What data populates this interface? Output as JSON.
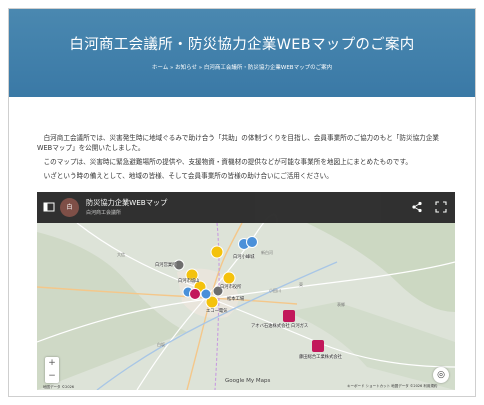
{
  "hero": {
    "title": "白河商工会議所・防災協力企業WEBマップのご案内",
    "breadcrumb_home": "ホーム",
    "breadcrumb_news": "お知らせ",
    "breadcrumb_current": "白河商工会議所・防災協力企業WEBマップのご案内",
    "breadcrumb_sep": "»"
  },
  "content": {
    "p1": "白河商工会議所では、災害発生時に地域ぐるみで助け合う「共助」の体制づくりを目指し、会員事業所のご協力のもと「防災協力企業WEBマップ」を公開いたしました。",
    "p2": "このマップは、災害時に緊急避難場所の提供や、支援物資・資機材の提供などが可能な事業所を地図上にまとめたものです。",
    "p3": "いざという時の備えとして、地域の皆様、そして会員事業所の皆様の助け合いにご活用ください。"
  },
  "map": {
    "avatar_text": "白",
    "title": "防災協力企業WEBマップ",
    "subtitle": "白河商工会議所",
    "logo": "Google My Maps",
    "attribution_left": "地図データ ©2026",
    "attribution_right": "キーボード ショートカット  地図データ ©2026  利用規約",
    "zoom_in": "+",
    "zoom_out": "−",
    "labels": {
      "shiroyama": "白河市城山",
      "kounodai": "白河小峰城",
      "office_a": "白河営業所",
      "office_b": "エコー電気",
      "office_c": "アオバ石油株式会社 白河ガス",
      "office_d": "藤田総合工業株式会社",
      "office_e": "白河市役所",
      "office_f": "松本工場"
    },
    "places": {
      "p1": "白坂",
      "p2": "表郷",
      "p3": "新白河",
      "p4": "大信",
      "p5": "東",
      "p6": "小田川"
    }
  },
  "colors": {
    "hero": "#3a79a6",
    "marker_yellow": "#f4c20d",
    "marker_pink": "#c2185b",
    "marker_blue": "#4a90d9",
    "marker_gray": "#6d6d6d"
  }
}
